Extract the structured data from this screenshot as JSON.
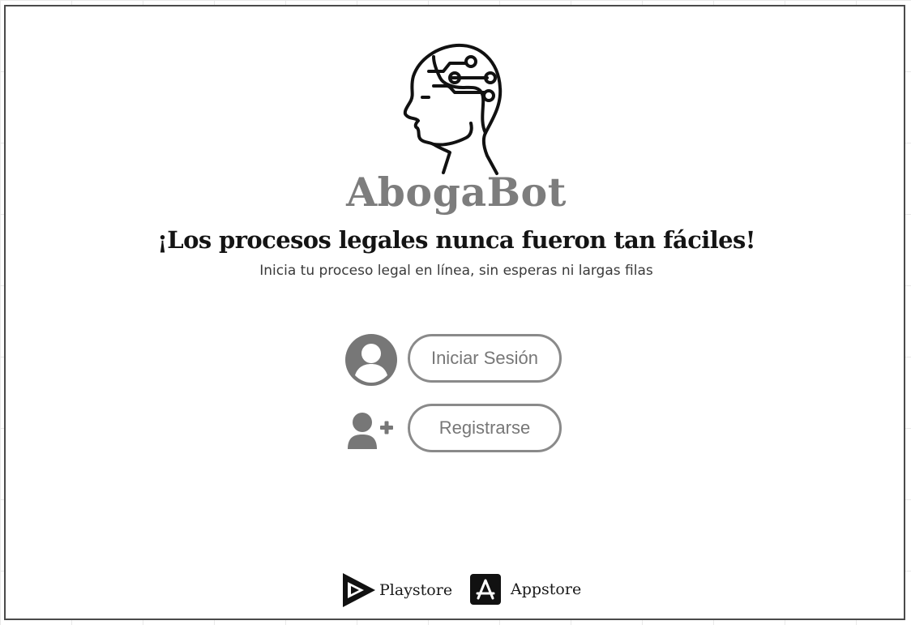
{
  "brand": {
    "name": "AbogaBot",
    "logo_icon": "ai-brain-head-icon"
  },
  "hero": {
    "headline": "¡Los procesos legales nunca fueron tan fáciles!",
    "subheadline": "Inicia tu proceso legal en línea, sin esperas ni largas filas"
  },
  "actions": {
    "login": {
      "label": "Iniciar Sesión",
      "icon": "user-circle-icon"
    },
    "register": {
      "label": "Registrarse",
      "icon": "user-plus-icon"
    }
  },
  "stores": [
    {
      "label": "Playstore",
      "icon": "playstore-icon"
    },
    {
      "label": "Appstore",
      "icon": "appstore-icon"
    }
  ],
  "colors": {
    "brand_gray": "#7d7d7d",
    "button_border": "#8a8a8a",
    "icon_gray": "#777777",
    "text_dark": "#141414"
  }
}
